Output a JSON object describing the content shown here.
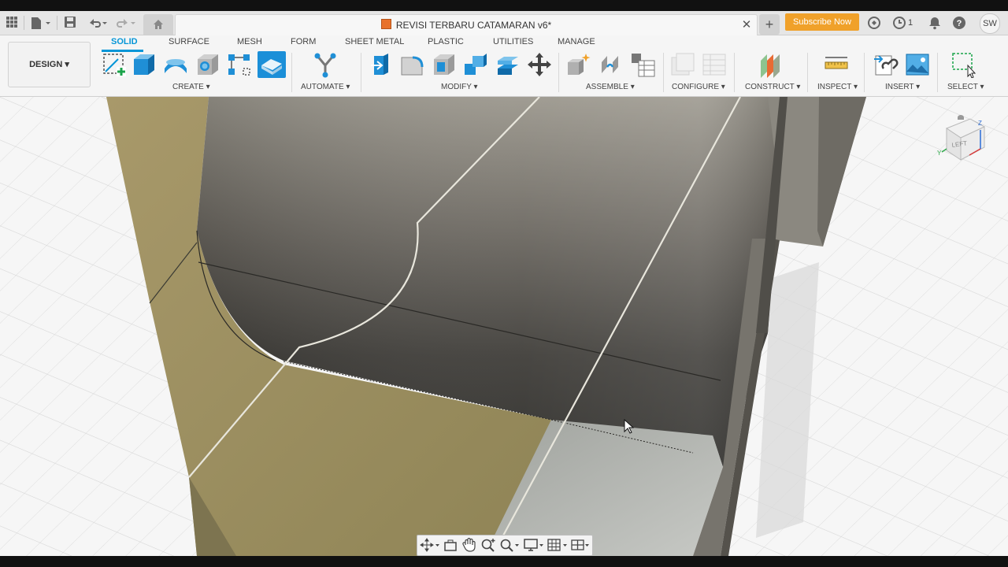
{
  "window": {
    "title": "REVISI TERBARU CATAMARAN v6*",
    "subscribe_label": "Subscribe Now",
    "job_count": "1",
    "user_initials": "SW"
  },
  "workspace": {
    "label": "DESIGN"
  },
  "ribbon_tabs": [
    {
      "label": "SOLID",
      "active": true
    },
    {
      "label": "SURFACE"
    },
    {
      "label": "MESH"
    },
    {
      "label": "FORM"
    },
    {
      "label": "SHEET METAL"
    },
    {
      "label": "PLASTIC"
    },
    {
      "label": "UTILITIES"
    },
    {
      "label": "MANAGE"
    }
  ],
  "groups": {
    "create": "CREATE",
    "automate": "AUTOMATE",
    "modify": "MODIFY",
    "assemble": "ASSEMBLE",
    "configure": "CONFIGURE",
    "construct": "CONSTRUCT",
    "inspect": "INSPECT",
    "insert": "INSERT",
    "select": "SELECT"
  },
  "viewcube": {
    "face": "LEFT"
  },
  "colors": {
    "accent": "#0696d7",
    "subscribe": "#f0a12a",
    "body_dark": "#6b6862",
    "body_face": "#9c8f5e"
  },
  "icons": [
    "grid-menu-icon",
    "file-icon",
    "save-icon",
    "undo-icon",
    "redo-icon",
    "home-icon",
    "extensions-icon",
    "job-status-icon",
    "notifications-icon",
    "help-icon",
    "create-sketch-icon",
    "extrude-icon",
    "revolve-icon",
    "hole-icon",
    "pattern-icon",
    "derive-icon",
    "automate-icon",
    "press-pull-icon",
    "fillet-icon",
    "shell-icon",
    "combine-icon",
    "offset-face-icon",
    "move-icon",
    "new-component-icon",
    "joint-icon",
    "bom-icon",
    "configure-icon",
    "table-icon",
    "offset-plane-icon",
    "measure-icon",
    "insert-mesh-icon",
    "insert-canvas-icon",
    "select-icon",
    "orbit-icon",
    "look-at-icon",
    "pan-icon",
    "zoom-icon",
    "fit-icon",
    "display-settings-icon",
    "grid-settings-icon",
    "viewports-icon"
  ]
}
